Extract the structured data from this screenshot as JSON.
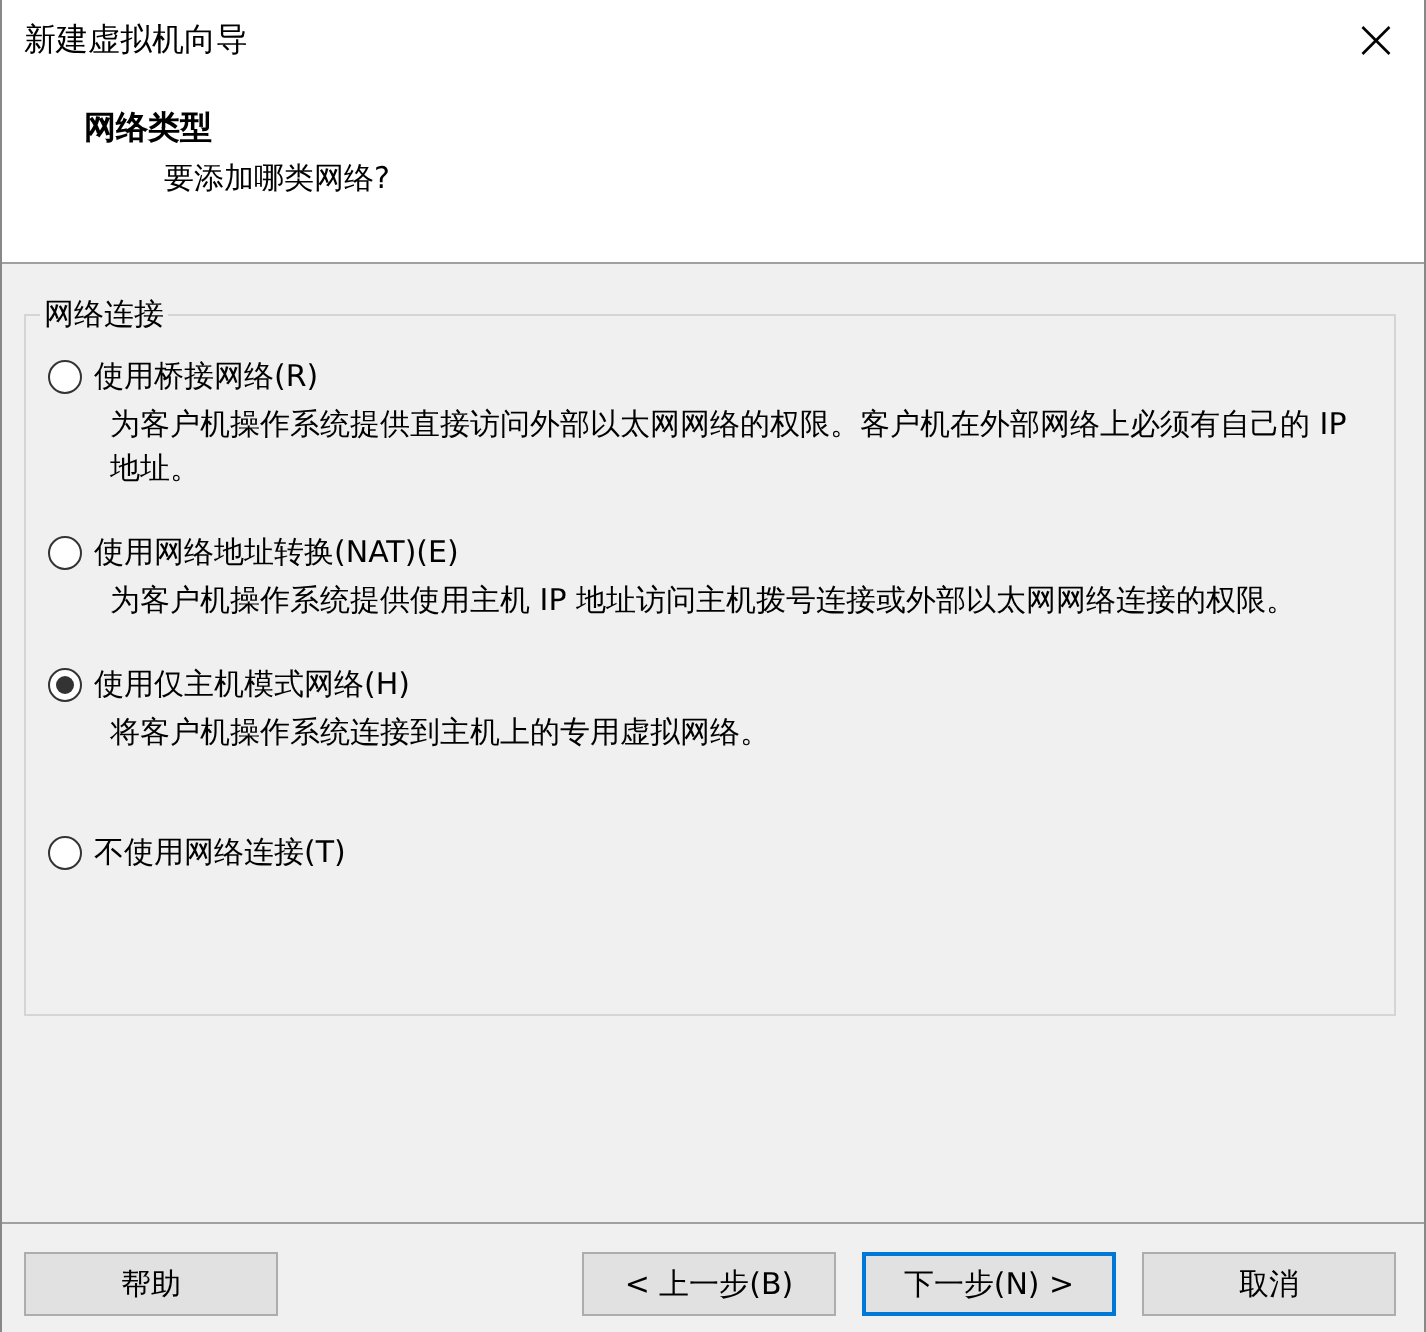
{
  "window": {
    "title": "新建虚拟机向导",
    "close": "×"
  },
  "header": {
    "title": "网络类型",
    "subtitle": "要添加哪类网络?"
  },
  "group": {
    "title": "网络连接",
    "options": [
      {
        "label": "使用桥接网络(R)",
        "description": "为客户机操作系统提供直接访问外部以太网网络的权限。客户机在外部网络上必须有自己的 IP 地址。",
        "selected": false
      },
      {
        "label": "使用网络地址转换(NAT)(E)",
        "description": "为客户机操作系统提供使用主机 IP 地址访问主机拨号连接或外部以太网网络连接的权限。",
        "selected": false
      },
      {
        "label": "使用仅主机模式网络(H)",
        "description": "将客户机操作系统连接到主机上的专用虚拟网络。",
        "selected": true
      },
      {
        "label": "不使用网络连接(T)",
        "selected": false
      }
    ]
  },
  "buttons": [
    {
      "label": "帮助",
      "focused": false
    },
    {
      "label": "< 上一步(B)",
      "focused": false
    },
    {
      "label": "下一步(N) >",
      "focused": true
    },
    {
      "label": "取消",
      "focused": false
    }
  ]
}
